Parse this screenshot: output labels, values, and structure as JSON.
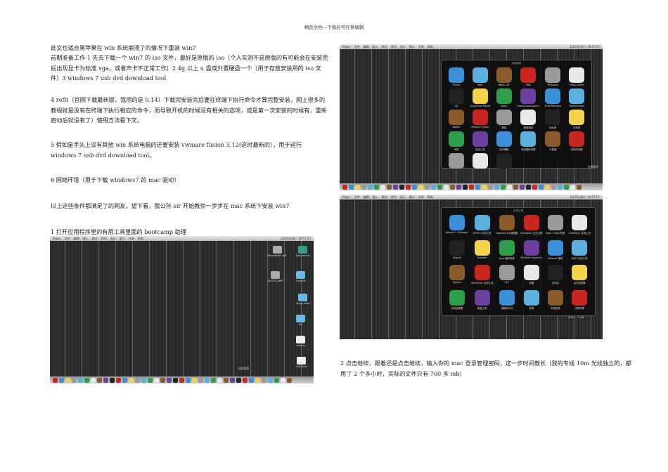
{
  "header": "精品文档---下载后可任意编辑",
  "paragraphs": [
    "此文也适合黑苹果在 win 系统崩溃了的情况下重装 win7",
    "前期准备工作 1  先去下载一个 win7 的 iso 文件，最好是原版的 iso（个人实测不是原版的有可能会在安装完后出现显卡为标准 vga，或者声卡不正常工作）2   4g 以上 u 盘或外置硬盘一个（用于存放安装用的 iso 文件）3  windows 7 usb dvd download tool",
    "4 refit（官网下载最新版，我用的是 0.14）下载完安装完后要在终端下执行命令才算完整安装，网上很多的教程就是没有在终端下执行相应的命令，而导致开机的时候没有相关的选项，或是第一次安装的时候有，重新启动后就没有了）使用方法看下文。",
    "5 假如是手头上没有其他 win 系统电脑的还要安装 vwmare fusion 3.12(这时最新的），用于运行 windows 7 usb dvd download tool。",
    "6 网络环境（用于下载 windows7 的    mac 驱动）",
    "以上这些条件都满足了的网友，望下看，我公孙 sir 开始教你一步步在 mac 系统下安装 win7",
    "1 打开应用程序里的有用工具里面的 bootcamp 助理",
    "2 点击继续，跟着还是点击继续，输入你的 mac 登录管理密码，这一步时间教长（我的专线 10m 光线独立的，都用了 2 个多小时，实际的文件只有 700 多 mb）"
  ],
  "screenshot1": {
    "menubar": [
      "Pages",
      "文件",
      "编辑",
      "插入",
      "格式",
      "排列",
      "显示",
      "窗口",
      "共享",
      "帮助"
    ],
    "status": "2月26日周六 19:57:57",
    "desktop_items": [
      "Macintosh HD",
      "Document",
      "BOOTCAMP",
      "tutorial",
      "temp data",
      "Inc",
      "memo",
      "Untitled"
    ],
    "stack_label": "应用程序"
  },
  "screenshot2": {
    "title": "实用程序",
    "apps": [
      "iTunes",
      "Web",
      "iWork '09",
      "Mail",
      "HPSpace",
      "Photo Booth",
      "QQ",
      "QuickTime Player",
      "Safari",
      "Speed Download 5",
      "Time Machine",
      "Transmission",
      "Twitter",
      "VMware Fusion",
      "便笺",
      "图像捕捉",
      "地址簿",
      "字体册",
      "字典",
      "实用工具",
      "文本编辑",
      "系统偏好设置",
      "计算器",
      "谷歌浏览器",
      "",
      "",
      ""
    ],
    "corner": "应用程序"
  },
  "screenshot3": {
    "title": "实用工具",
    "apps": [
      "Adobe Fl. Manager",
      "AirPort 实用工具",
      "AppleScript 编辑器",
      "Bluetooth 文件交换",
      "Boot Camp 助理",
      "ColorSync 实用工具",
      "Exposé",
      "Grapher",
      "Java 偏好设置",
      "Partition Inspector",
      "Podcast 捕捉",
      "RAID 实用工具",
      "Spaces",
      "VoiceOver 实用工具",
      "X11",
      "抓图",
      "控制台",
      "活动监视器",
      "活动监视器",
      "磁盘工具",
      "钥匙串访问",
      "终端",
      "系统信息",
      "迁移助理"
    ],
    "corner": "2011 . 7 GB"
  },
  "colors": [
    "#c8261e",
    "#3a8fd8",
    "#f2d24a",
    "#9a9a9a",
    "#5bb0e0",
    "#2f9e4a",
    "#e8e8e8",
    "#8a5a2a",
    "#6b3fa0",
    "#222"
  ]
}
